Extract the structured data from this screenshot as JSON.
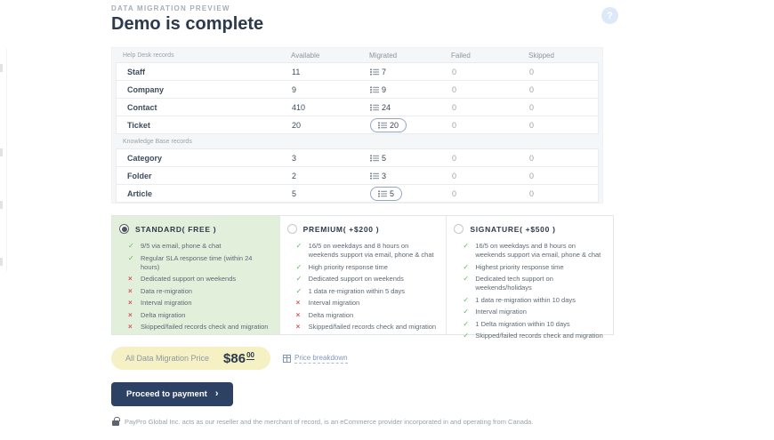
{
  "page": {
    "eyebrow": "DATA MIGRATION PREVIEW",
    "title": "Demo is complete"
  },
  "icons": {
    "help": "?",
    "check": "✓",
    "cross": "×",
    "chevron": "›"
  },
  "colors": {
    "heading": "#2c3a4b",
    "check_green": "#5cb85c",
    "cross_red": "#d9534f",
    "selected_plan_bg": "#e2efdb",
    "price_highlight": "#f5f1c4",
    "link_blue": "#8296ba",
    "button_bg": "#2d4164",
    "boxed_border": "#93a7c4"
  },
  "table": {
    "columns": [
      "Available",
      "Migrated",
      "Failed",
      "Skipped"
    ],
    "sections": [
      {
        "label": "Help Desk records",
        "rows": [
          {
            "name": "Staff",
            "available": "11",
            "migrated": "7",
            "boxed": false,
            "failed": "0",
            "skipped": "0"
          },
          {
            "name": "Company",
            "available": "9",
            "migrated": "9",
            "boxed": false,
            "failed": "0",
            "skipped": "0"
          },
          {
            "name": "Contact",
            "available": "410",
            "migrated": "24",
            "boxed": false,
            "failed": "0",
            "skipped": "0"
          },
          {
            "name": "Ticket",
            "available": "20",
            "migrated": "20",
            "boxed": true,
            "failed": "0",
            "skipped": "0"
          }
        ]
      },
      {
        "label": "Knowledge Base records",
        "rows": [
          {
            "name": "Category",
            "available": "3",
            "migrated": "5",
            "boxed": false,
            "failed": "0",
            "skipped": "0"
          },
          {
            "name": "Folder",
            "available": "2",
            "migrated": "3",
            "boxed": false,
            "failed": "0",
            "skipped": "0"
          },
          {
            "name": "Article",
            "available": "5",
            "migrated": "5",
            "boxed": true,
            "failed": "0",
            "skipped": "0"
          }
        ]
      }
    ]
  },
  "plans": [
    {
      "name": "STANDARD( FREE )",
      "selected": true,
      "features": [
        {
          "ok": true,
          "text": "9/5 via email, phone & chat"
        },
        {
          "ok": true,
          "text": "Regular SLA response time (within 24 hours)"
        },
        {
          "ok": false,
          "text": "Dedicated support on weekends"
        },
        {
          "ok": false,
          "text": "Data re-migration"
        },
        {
          "ok": false,
          "text": "Interval migration"
        },
        {
          "ok": false,
          "text": "Delta migration"
        },
        {
          "ok": false,
          "text": "Skipped/failed records check and migration"
        }
      ]
    },
    {
      "name": "PREMIUM( +$200 )",
      "selected": false,
      "features": [
        {
          "ok": true,
          "text": "16/5 on weekdays and 8 hours on weekends support via email, phone & chat"
        },
        {
          "ok": true,
          "text": "High priority response time"
        },
        {
          "ok": true,
          "text": "Dedicated support on weekends"
        },
        {
          "ok": true,
          "text": "1 data re-migration within 5 days"
        },
        {
          "ok": false,
          "text": "Interval migration"
        },
        {
          "ok": false,
          "text": "Delta migration"
        },
        {
          "ok": false,
          "text": "Skipped/failed records check and migration"
        }
      ]
    },
    {
      "name": "SIGNATURE( +$500 )",
      "selected": false,
      "features": [
        {
          "ok": true,
          "text": "16/5 on weekdays and 8 hours on weekends support via email, phone & chat"
        },
        {
          "ok": true,
          "text": "Highest priority response time"
        },
        {
          "ok": true,
          "text": "Dedicated tech support on weekends/holidays"
        },
        {
          "ok": true,
          "text": "1 data re-migration within 10 days"
        },
        {
          "ok": true,
          "text": "Interval migration"
        },
        {
          "ok": true,
          "text": "1 Delta migration within 10 days"
        },
        {
          "ok": true,
          "text": "Skipped/failed records check and migration"
        }
      ]
    }
  ],
  "price": {
    "label": "All Data Migration Price",
    "amount": "$86",
    "cents": "00",
    "breakdown_label": "Price breakdown"
  },
  "payment": {
    "button_label": "Proceed to payment"
  },
  "footer": {
    "text": "PayPro Global Inc. acts as our reseller and the merchant of record, is an eCommerce provider incorporated in and operating from Canada."
  }
}
